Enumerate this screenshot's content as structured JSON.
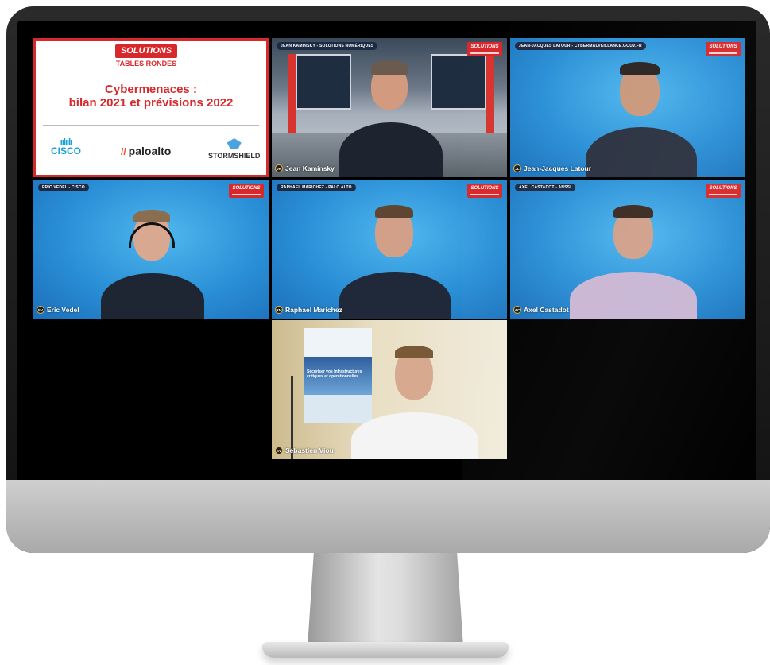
{
  "slide": {
    "brand_main": "SOLUTIONS",
    "brand_sub": "TABLES RONDES",
    "title_line1": "Cybermenaces :",
    "title_line2": "bilan 2021 et prévisions 2022",
    "sponsors": {
      "cisco": "CISCO",
      "paloalto": "paloalto",
      "stormshield": "STORMSHIELD"
    }
  },
  "participants": [
    {
      "top_label": "JEAN KAMINSKY - SOLUTIONS NUMÉRIQUES",
      "initials": "JK",
      "name": "Jean Kaminsky"
    },
    {
      "top_label": "JEAN-JACQUES LATOUR - CYBERMALVEILLANCE.GOUV.FR",
      "initials": "JL",
      "name": "Jean-Jacques Latour"
    },
    {
      "top_label": "ERIC VEDEL - CISCO",
      "initials": "EV",
      "name": "Eric Vedel"
    },
    {
      "top_label": "RAPHAEL MARICHEZ - PALO ALTO",
      "initials": "RM",
      "name": "Raphael Marichez"
    },
    {
      "top_label": "AXEL CASTADOT - ANSSI",
      "initials": "AC",
      "name": "Axel Castadot"
    },
    {
      "top_label": "",
      "initials": "SV",
      "name": "Sébastien Viou"
    }
  ],
  "tile_logo": "SOLUTIONS",
  "poster_text": "Sécuriser vos infrastructures critiques et opérationnelles",
  "colors": {
    "brand_red": "#d7282b",
    "tile_blue": "#2a8fd6",
    "label_bg": "#1c2a44"
  }
}
